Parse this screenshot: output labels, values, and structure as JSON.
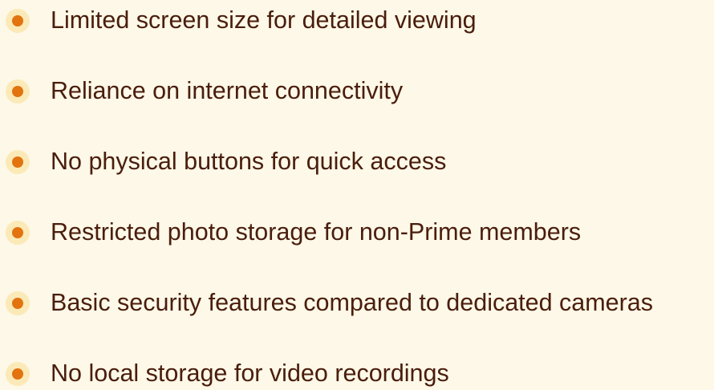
{
  "list": {
    "items": [
      {
        "text": "Limited screen size for detailed viewing",
        "bullet_icon": "dot-bullet-icon"
      },
      {
        "text": "Reliance on internet connectivity",
        "bullet_icon": "dot-bullet-icon"
      },
      {
        "text": "No physical buttons for quick access",
        "bullet_icon": "dot-bullet-icon"
      },
      {
        "text": "Restricted photo storage for non-Prime members",
        "bullet_icon": "dot-bullet-icon"
      },
      {
        "text": "Basic security features compared to dedicated cameras",
        "bullet_icon": "dot-bullet-icon"
      },
      {
        "text": "No local storage for video recordings",
        "bullet_icon": "dot-bullet-icon"
      }
    ]
  },
  "colors": {
    "background": "#fdf8e7",
    "text": "#4a1d0d",
    "bullet_halo": "#fbeab8",
    "bullet_dot": "#e2730f"
  }
}
